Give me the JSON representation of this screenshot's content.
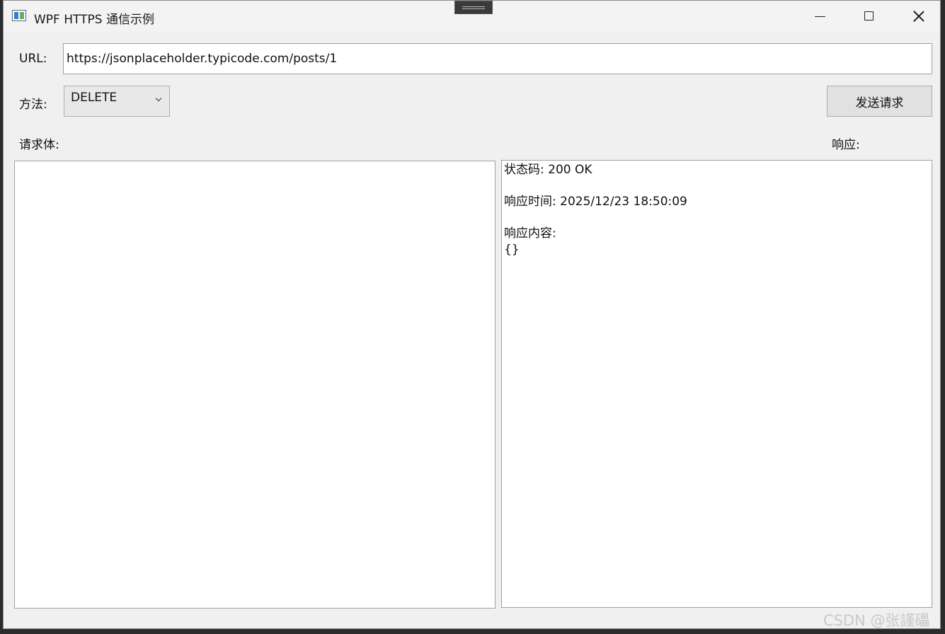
{
  "window": {
    "title": "WPF HTTPS 通信示例",
    "app_icon": "window-app-icon",
    "controls": {
      "minimize": "minimize-icon",
      "maximize": "maximize-icon",
      "close": "close-icon"
    }
  },
  "form": {
    "url_label": "URL:",
    "url_value": "https://jsonplaceholder.typicode.com/posts/1",
    "method_label": "方法:",
    "method_value": "DELETE",
    "send_label": "发送请求",
    "body_label": "请求体:",
    "body_value": "",
    "response_label": "响应:"
  },
  "response": {
    "status_line": "状态码: 200 OK",
    "time_line": "响应时间: 2025/12/23 18:50:09",
    "content_label": "响应内容:",
    "content_value": "{}"
  },
  "watermark": "CSDN @张謹礧",
  "colors": {
    "window_bg": "#f0f0f0",
    "titlebar_bg": "#f3f3f3",
    "button_bg": "#e1e1e1"
  }
}
